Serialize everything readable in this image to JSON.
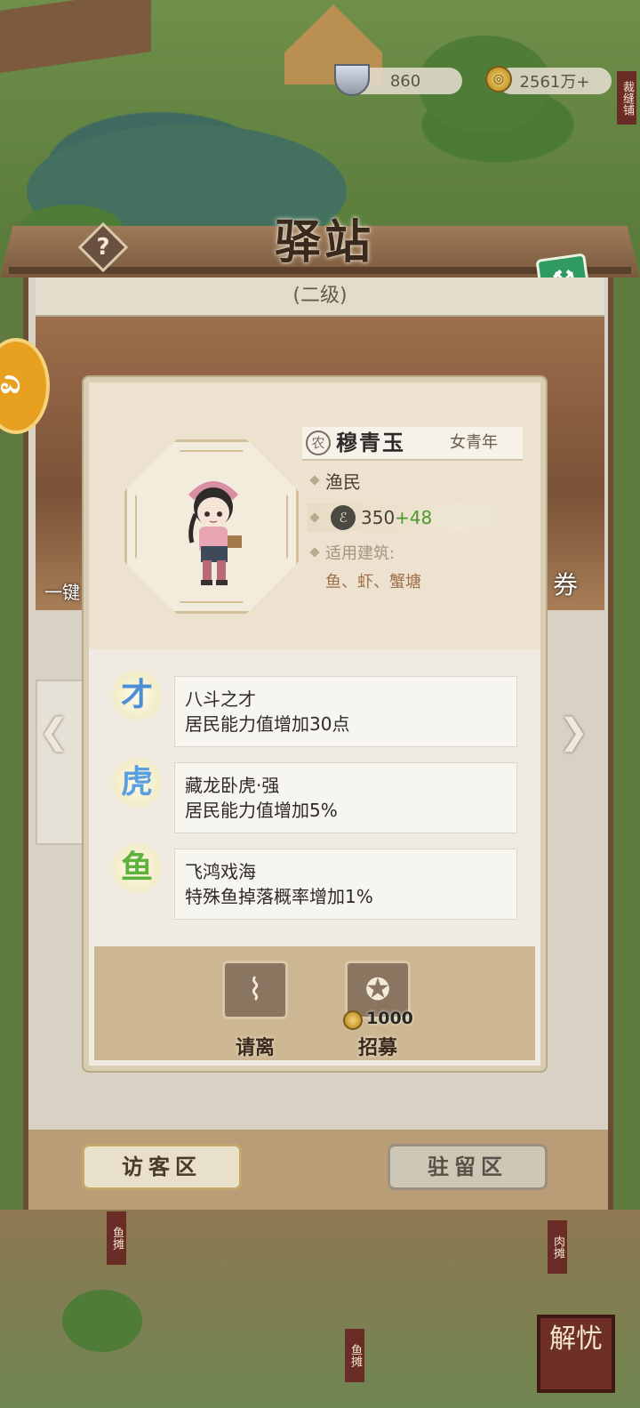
{
  "resources": {
    "silver": "860",
    "copper": "2561万+"
  },
  "header": {
    "title": "驿站",
    "level": "(二级)"
  },
  "background": {
    "one_click_label": "一键",
    "coupon_label": "券",
    "stall_fish": "鱼摊",
    "stall_meat": "肉摊",
    "stall_fish2": "鱼摊",
    "shop_sew": "裁缝铺",
    "jieyou": "解忧"
  },
  "resident": {
    "badge": "农",
    "name": "穆青玉",
    "gender_age": "女青年",
    "occupation": "渔民",
    "power": "350",
    "power_bonus": "+48",
    "suitable_label": "适用建筑:",
    "suitable_buildings": "鱼、虾、蟹塘"
  },
  "skills": [
    {
      "icon": "talent-icon",
      "glyph": "才",
      "name": "八斗之才",
      "desc": "居民能力值增加30点",
      "color": "#4d8fd6"
    },
    {
      "icon": "tiger-icon",
      "glyph": "虎",
      "name": "藏龙卧虎·强",
      "desc": "居民能力值增加5%",
      "color": "#5aa0e0"
    },
    {
      "icon": "leaf-fish-icon",
      "glyph": "鱼",
      "name": "飞鸿戏海",
      "desc": "特殊鱼掉落概率增加1%",
      "color": "#5fb13d"
    }
  ],
  "actions": {
    "dismiss": "请离",
    "recruit": "招募",
    "recruit_cost": "1000"
  },
  "tabs": {
    "visitor": "访客区",
    "resident": "驻留区"
  }
}
